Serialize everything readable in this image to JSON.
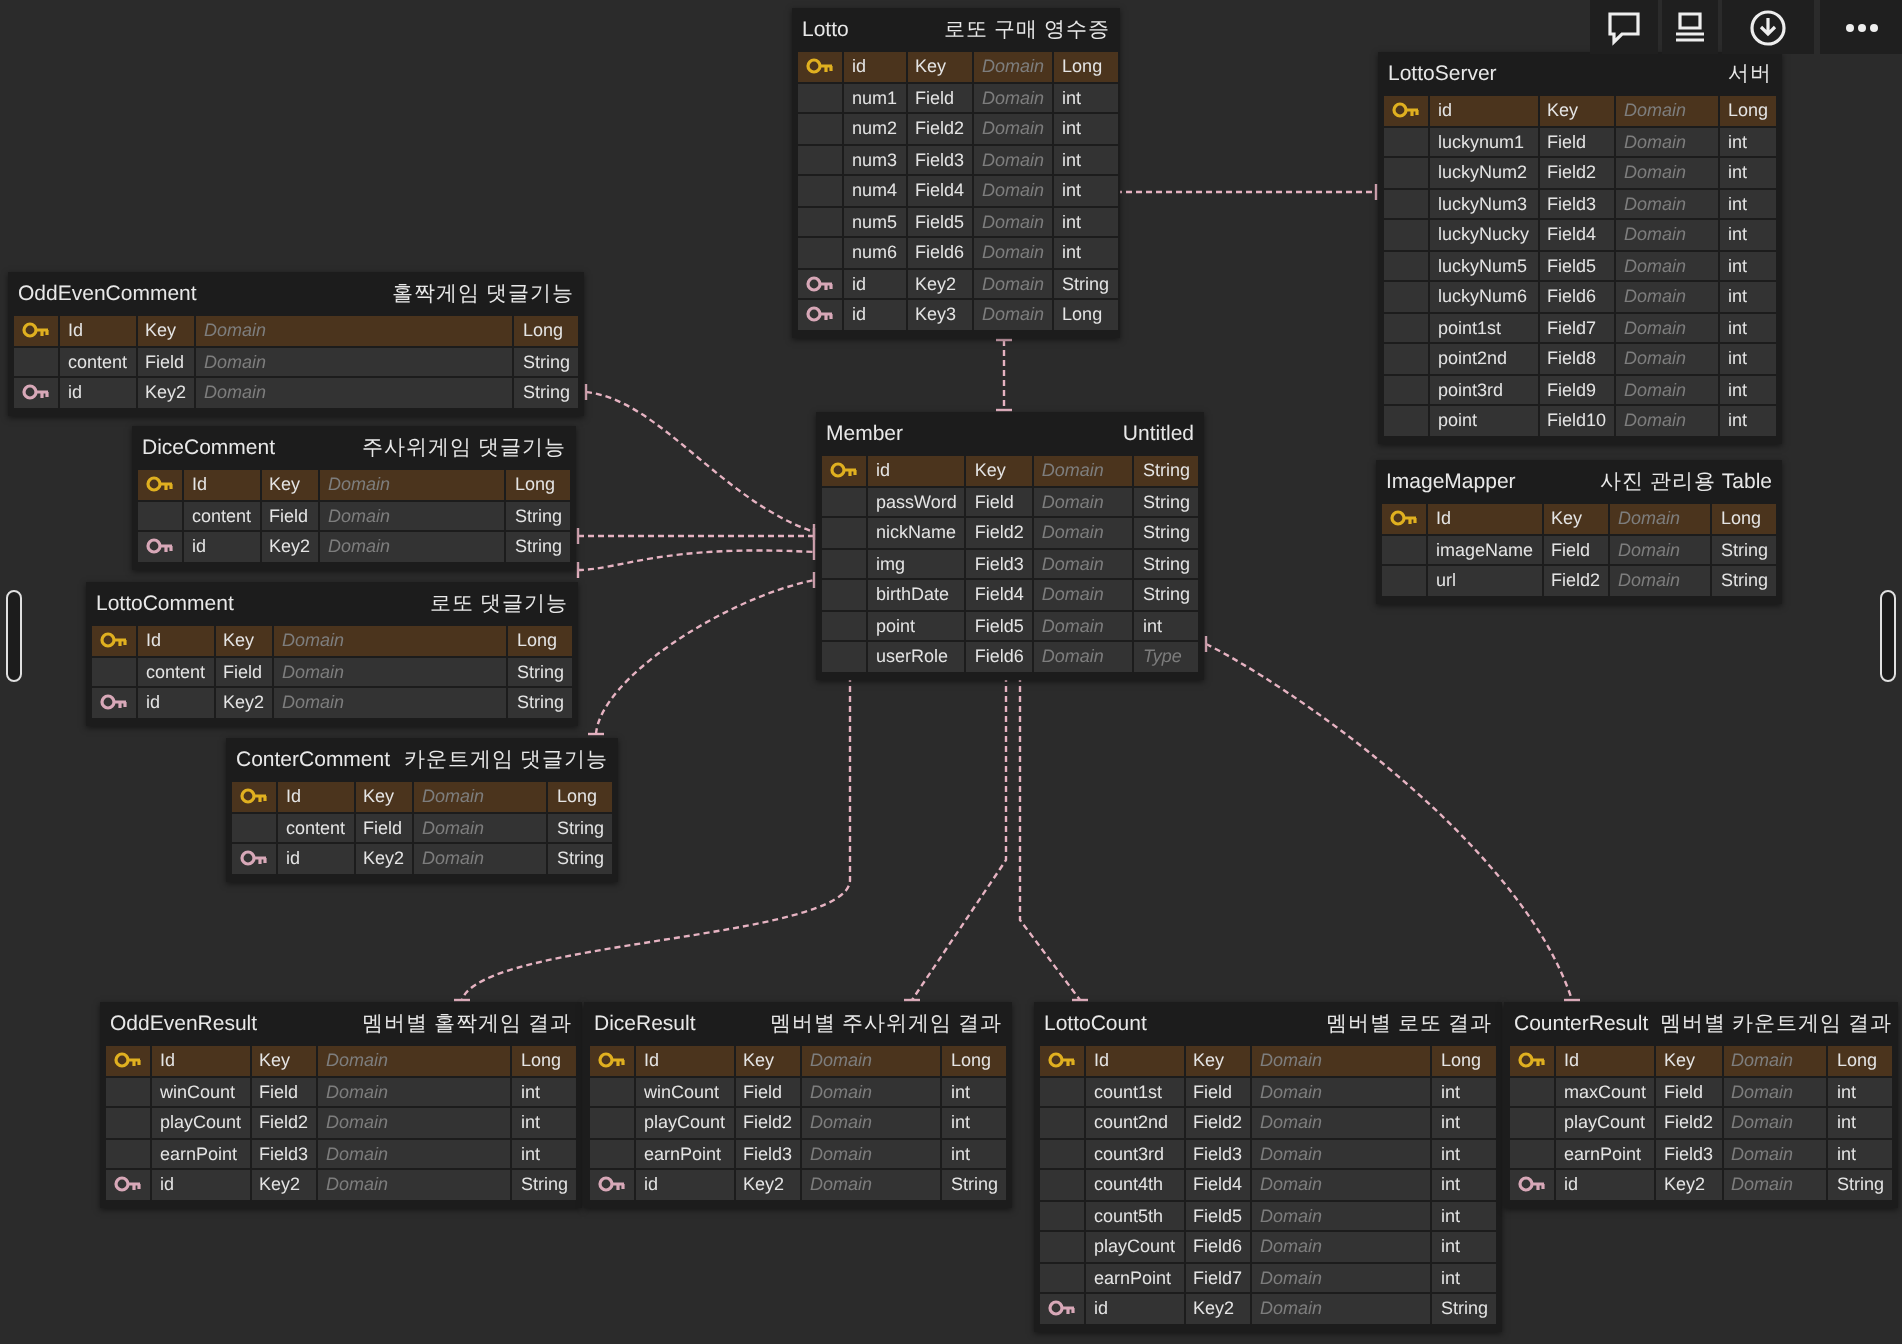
{
  "tables": [
    {
      "name": "Lotto",
      "comment": "로또 구매 영수증",
      "columns": [
        {
          "kind": "primary-key",
          "name": "id",
          "logical": "Key",
          "domain_placeholder": "Domain",
          "type": "Long"
        },
        {
          "kind": "plain",
          "name": "num1",
          "logical": "Field",
          "domain_placeholder": "Domain",
          "type": "int"
        },
        {
          "kind": "plain",
          "name": "num2",
          "logical": "Field2",
          "domain_placeholder": "Domain",
          "type": "int"
        },
        {
          "kind": "plain",
          "name": "num3",
          "logical": "Field3",
          "domain_placeholder": "Domain",
          "type": "int"
        },
        {
          "kind": "plain",
          "name": "num4",
          "logical": "Field4",
          "domain_placeholder": "Domain",
          "type": "int"
        },
        {
          "kind": "plain",
          "name": "num5",
          "logical": "Field5",
          "domain_placeholder": "Domain",
          "type": "int"
        },
        {
          "kind": "plain",
          "name": "num6",
          "logical": "Field6",
          "domain_placeholder": "Domain",
          "type": "int"
        },
        {
          "kind": "foreign-key",
          "name": "id",
          "logical": "Key2",
          "domain_placeholder": "Domain",
          "type": "String"
        },
        {
          "kind": "foreign-key",
          "name": "id",
          "logical": "Key3",
          "domain_placeholder": "Domain",
          "type": "Long"
        }
      ]
    },
    {
      "name": "LottoServer",
      "comment": "서버",
      "columns": [
        {
          "kind": "primary-key",
          "name": "id",
          "logical": "Key",
          "domain_placeholder": "Domain",
          "type": "Long"
        },
        {
          "kind": "plain",
          "name": "luckynum1",
          "logical": "Field",
          "domain_placeholder": "Domain",
          "type": "int"
        },
        {
          "kind": "plain",
          "name": "luckyNum2",
          "logical": "Field2",
          "domain_placeholder": "Domain",
          "type": "int"
        },
        {
          "kind": "plain",
          "name": "luckyNum3",
          "logical": "Field3",
          "domain_placeholder": "Domain",
          "type": "int"
        },
        {
          "kind": "plain",
          "name": "luckyNucky",
          "logical": "Field4",
          "domain_placeholder": "Domain",
          "type": "int"
        },
        {
          "kind": "plain",
          "name": "luckyNum5",
          "logical": "Field5",
          "domain_placeholder": "Domain",
          "type": "int"
        },
        {
          "kind": "plain",
          "name": "luckyNum6",
          "logical": "Field6",
          "domain_placeholder": "Domain",
          "type": "int"
        },
        {
          "kind": "plain",
          "name": "point1st",
          "logical": "Field7",
          "domain_placeholder": "Domain",
          "type": "int"
        },
        {
          "kind": "plain",
          "name": "point2nd",
          "logical": "Field8",
          "domain_placeholder": "Domain",
          "type": "int"
        },
        {
          "kind": "plain",
          "name": "point3rd",
          "logical": "Field9",
          "domain_placeholder": "Domain",
          "type": "int"
        },
        {
          "kind": "plain",
          "name": "point",
          "logical": "Field10",
          "domain_placeholder": "Domain",
          "type": "int"
        }
      ]
    },
    {
      "name": "OddEvenComment",
      "comment": "홀짝게임 댓글기능",
      "columns": [
        {
          "kind": "primary-key",
          "name": "Id",
          "logical": "Key",
          "domain_placeholder": "Domain",
          "type": "Long"
        },
        {
          "kind": "plain",
          "name": "content",
          "logical": "Field",
          "domain_placeholder": "Domain",
          "type": "String"
        },
        {
          "kind": "foreign-key",
          "name": "id",
          "logical": "Key2",
          "domain_placeholder": "Domain",
          "type": "String"
        }
      ]
    },
    {
      "name": "DiceComment",
      "comment": "주사위게임 댓글기능",
      "columns": [
        {
          "kind": "primary-key",
          "name": "Id",
          "logical": "Key",
          "domain_placeholder": "Domain",
          "type": "Long"
        },
        {
          "kind": "plain",
          "name": "content",
          "logical": "Field",
          "domain_placeholder": "Domain",
          "type": "String"
        },
        {
          "kind": "foreign-key",
          "name": "id",
          "logical": "Key2",
          "domain_placeholder": "Domain",
          "type": "String"
        }
      ]
    },
    {
      "name": "LottoComment",
      "comment": "로또 댓글기능",
      "columns": [
        {
          "kind": "primary-key",
          "name": "Id",
          "logical": "Key",
          "domain_placeholder": "Domain",
          "type": "Long"
        },
        {
          "kind": "plain",
          "name": "content",
          "logical": "Field",
          "domain_placeholder": "Domain",
          "type": "String"
        },
        {
          "kind": "foreign-key",
          "name": "id",
          "logical": "Key2",
          "domain_placeholder": "Domain",
          "type": "String"
        }
      ]
    },
    {
      "name": "ConterComment",
      "comment": "카운트게임 댓글기능",
      "columns": [
        {
          "kind": "primary-key",
          "name": "Id",
          "logical": "Key",
          "domain_placeholder": "Domain",
          "type": "Long"
        },
        {
          "kind": "plain",
          "name": "content",
          "logical": "Field",
          "domain_placeholder": "Domain",
          "type": "String"
        },
        {
          "kind": "foreign-key",
          "name": "id",
          "logical": "Key2",
          "domain_placeholder": "Domain",
          "type": "String"
        }
      ]
    },
    {
      "name": "Member",
      "comment": "Untitled",
      "columns": [
        {
          "kind": "primary-key",
          "name": "id",
          "logical": "Key",
          "domain_placeholder": "Domain",
          "type": "String"
        },
        {
          "kind": "plain",
          "name": "passWord",
          "logical": "Field",
          "domain_placeholder": "Domain",
          "type": "String"
        },
        {
          "kind": "plain",
          "name": "nickName",
          "logical": "Field2",
          "domain_placeholder": "Domain",
          "type": "String"
        },
        {
          "kind": "plain",
          "name": "img",
          "logical": "Field3",
          "domain_placeholder": "Domain",
          "type": "String"
        },
        {
          "kind": "plain",
          "name": "birthDate",
          "logical": "Field4",
          "domain_placeholder": "Domain",
          "type": "String"
        },
        {
          "kind": "plain",
          "name": "point",
          "logical": "Field5",
          "domain_placeholder": "Domain",
          "type": "int"
        },
        {
          "kind": "plain",
          "name": "userRole",
          "logical": "Field6",
          "domain_placeholder": "Domain",
          "type_placeholder": "Type"
        }
      ]
    },
    {
      "name": "ImageMapper",
      "comment": "사진 관리용 Table",
      "columns": [
        {
          "kind": "primary-key",
          "name": "Id",
          "logical": "Key",
          "domain_placeholder": "Domain",
          "type": "Long"
        },
        {
          "kind": "plain",
          "name": "imageName",
          "logical": "Field",
          "domain_placeholder": "Domain",
          "type": "String"
        },
        {
          "kind": "plain",
          "name": "url",
          "logical": "Field2",
          "domain_placeholder": "Domain",
          "type": "String"
        }
      ]
    },
    {
      "name": "OddEvenResult",
      "comment": "멤버별 홀짝게임 결과",
      "columns": [
        {
          "kind": "primary-key",
          "name": "Id",
          "logical": "Key",
          "domain_placeholder": "Domain",
          "type": "Long"
        },
        {
          "kind": "plain",
          "name": "winCount",
          "logical": "Field",
          "domain_placeholder": "Domain",
          "type": "int"
        },
        {
          "kind": "plain",
          "name": "playCount",
          "logical": "Field2",
          "domain_placeholder": "Domain",
          "type": "int"
        },
        {
          "kind": "plain",
          "name": "earnPoint",
          "logical": "Field3",
          "domain_placeholder": "Domain",
          "type": "int"
        },
        {
          "kind": "foreign-key",
          "name": "id",
          "logical": "Key2",
          "domain_placeholder": "Domain",
          "type": "String"
        }
      ]
    },
    {
      "name": "DiceResult",
      "comment": "멤버별 주사위게임 결과",
      "columns": [
        {
          "kind": "primary-key",
          "name": "Id",
          "logical": "Key",
          "domain_placeholder": "Domain",
          "type": "Long"
        },
        {
          "kind": "plain",
          "name": "winCount",
          "logical": "Field",
          "domain_placeholder": "Domain",
          "type": "int"
        },
        {
          "kind": "plain",
          "name": "playCount",
          "logical": "Field2",
          "domain_placeholder": "Domain",
          "type": "int"
        },
        {
          "kind": "plain",
          "name": "earnPoint",
          "logical": "Field3",
          "domain_placeholder": "Domain",
          "type": "int"
        },
        {
          "kind": "foreign-key",
          "name": "id",
          "logical": "Key2",
          "domain_placeholder": "Domain",
          "type": "String"
        }
      ]
    },
    {
      "name": "LottoCount",
      "comment": "멤버별 로또 결과",
      "columns": [
        {
          "kind": "primary-key",
          "name": "Id",
          "logical": "Key",
          "domain_placeholder": "Domain",
          "type": "Long"
        },
        {
          "kind": "plain",
          "name": "count1st",
          "logical": "Field",
          "domain_placeholder": "Domain",
          "type": "int"
        },
        {
          "kind": "plain",
          "name": "count2nd",
          "logical": "Field2",
          "domain_placeholder": "Domain",
          "type": "int"
        },
        {
          "kind": "plain",
          "name": "count3rd",
          "logical": "Field3",
          "domain_placeholder": "Domain",
          "type": "int"
        },
        {
          "kind": "plain",
          "name": "count4th",
          "logical": "Field4",
          "domain_placeholder": "Domain",
          "type": "int"
        },
        {
          "kind": "plain",
          "name": "count5th",
          "logical": "Field5",
          "domain_placeholder": "Domain",
          "type": "int"
        },
        {
          "kind": "plain",
          "name": "playCount",
          "logical": "Field6",
          "domain_placeholder": "Domain",
          "type": "int"
        },
        {
          "kind": "plain",
          "name": "earnPoint",
          "logical": "Field7",
          "domain_placeholder": "Domain",
          "type": "int"
        },
        {
          "kind": "foreign-key",
          "name": "id",
          "logical": "Key2",
          "domain_placeholder": "Domain",
          "type": "String"
        }
      ]
    },
    {
      "name": "CounterResult",
      "comment": "멤버별 카운트게임 결과",
      "columns": [
        {
          "kind": "primary-key",
          "name": "Id",
          "logical": "Key",
          "domain_placeholder": "Domain",
          "type": "Long"
        },
        {
          "kind": "plain",
          "name": "maxCount",
          "logical": "Field",
          "domain_placeholder": "Domain",
          "type": "int"
        },
        {
          "kind": "plain",
          "name": "playCount",
          "logical": "Field2",
          "domain_placeholder": "Domain",
          "type": "int"
        },
        {
          "kind": "plain",
          "name": "earnPoint",
          "logical": "Field3",
          "domain_placeholder": "Domain",
          "type": "int"
        },
        {
          "kind": "foreign-key",
          "name": "id",
          "logical": "Key2",
          "domain_placeholder": "Domain",
          "type": "String"
        }
      ]
    }
  ]
}
